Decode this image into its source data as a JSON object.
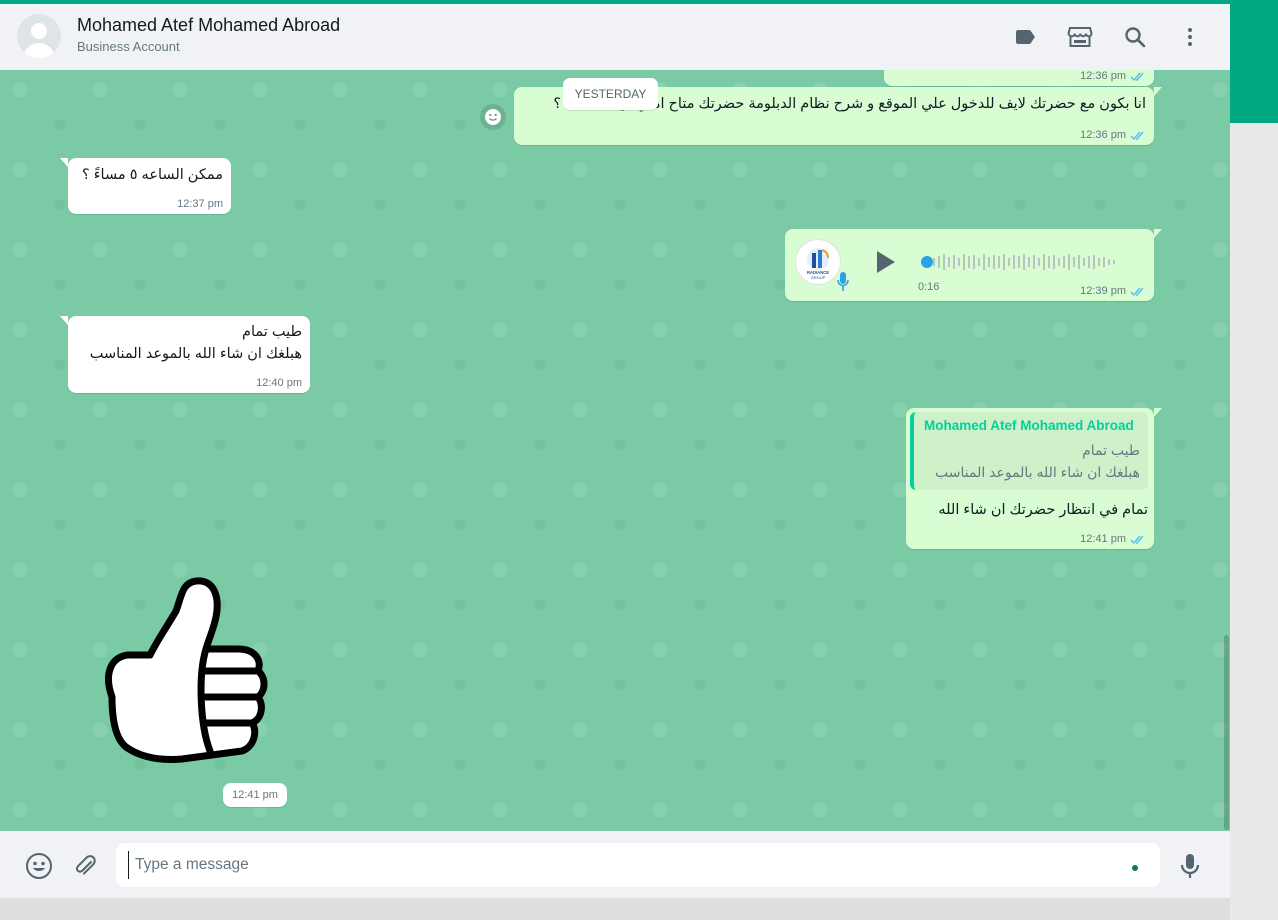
{
  "header": {
    "contact_name": "Mohamed Atef Mohamed Abroad",
    "contact_subtitle": "Business Account",
    "icons": [
      "label-icon",
      "catalog-store-icon",
      "search-icon",
      "menu-dots-icon"
    ]
  },
  "chat": {
    "date_separator": "YESTERDAY",
    "messages": [
      {
        "direction": "out",
        "text": "",
        "time": "12:36 pm",
        "status": "read"
      },
      {
        "direction": "out",
        "text": "انا بكون مع حضرتك لايف للدخول علي الموقع و شرح نظام الدبلومة حضرتك متاح امتي ان شاء الله ؟",
        "time": "12:36 pm",
        "status": "read"
      },
      {
        "direction": "in",
        "text": "ممكن الساعه ٥ مساءً ؟",
        "time": "12:37 pm"
      },
      {
        "direction": "out",
        "type": "voice",
        "duration": "0:16",
        "time": "12:39 pm",
        "status": "read",
        "avatar_brand": "RADIANCE GROUP"
      },
      {
        "direction": "in",
        "lines": [
          "طيب تمام",
          "هبلغك ان شاء الله بالموعد المناسب"
        ],
        "time": "12:40 pm"
      },
      {
        "direction": "out",
        "quote": {
          "author": "Mohamed Atef Mohamed Abroad",
          "lines": [
            "طيب تمام",
            "هبلغك ان شاء الله بالموعد المناسب"
          ]
        },
        "text": "تمام في انتظار حضرتك ان شاء الله",
        "time": "12:41 pm",
        "status": "read"
      },
      {
        "direction": "in",
        "type": "sticker",
        "sticker": "thumbs-up",
        "time": "12:41 pm"
      }
    ]
  },
  "footer": {
    "input_placeholder": "Type a message",
    "icons": [
      "emoji-icon",
      "attach-icon",
      "mic-icon"
    ]
  },
  "colors": {
    "accent": "#00a884",
    "chat_background": "#7acba5",
    "outgoing_bubble": "#d9fdd3",
    "incoming_bubble": "#ffffff",
    "read_ticks": "#53bdeb",
    "quote_bar": "#06cf9c"
  }
}
